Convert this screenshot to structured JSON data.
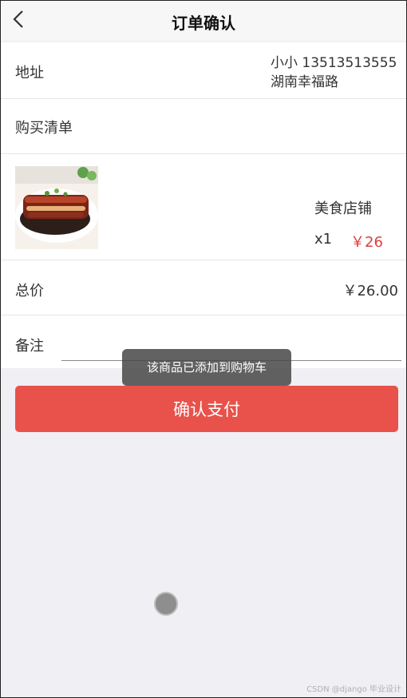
{
  "header": {
    "title": "订单确认",
    "back_icon": "chevron-left-icon"
  },
  "address": {
    "label": "地址",
    "contact": "小小 13513513555",
    "street": "湖南幸福路"
  },
  "shopping_list": {
    "label": "购买清单"
  },
  "item": {
    "image_desc_icon": "food-dish-image",
    "shop_name": "美食店铺",
    "quantity": "x1",
    "price": "￥26"
  },
  "total": {
    "label": "总价",
    "value": "￥26.00"
  },
  "note": {
    "label": "备注",
    "value": ""
  },
  "confirm_button": {
    "label": "确认支付"
  },
  "toast": {
    "message": "该商品已添加到购物车"
  },
  "watermark": "CSDN @django 毕业设计",
  "colors": {
    "accent": "#e8524a",
    "price": "#e03c3c",
    "background": "#f0eff4"
  }
}
